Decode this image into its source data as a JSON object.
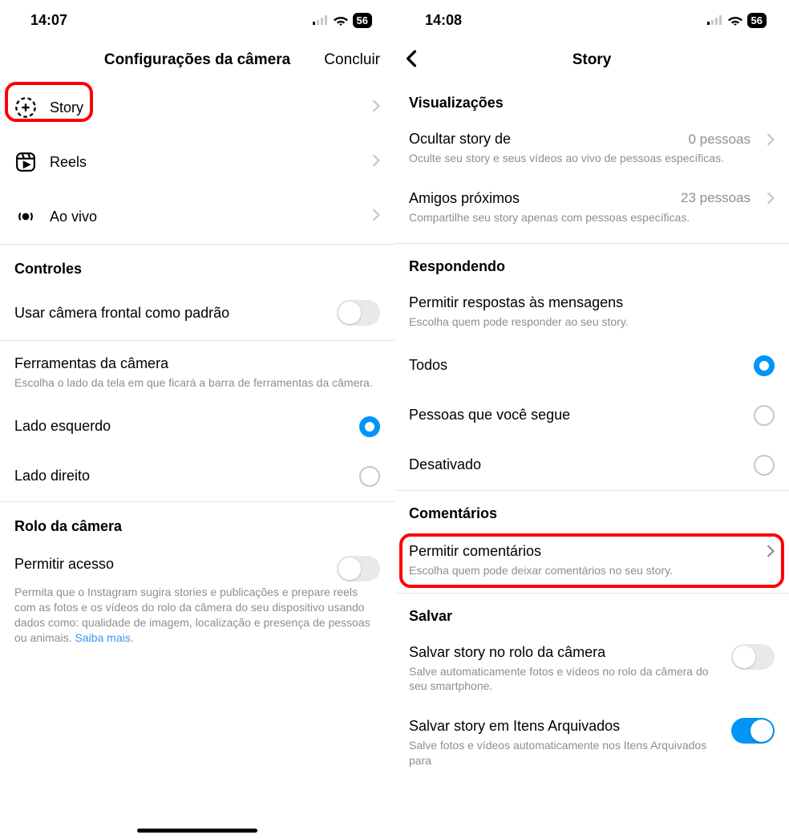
{
  "left": {
    "status": {
      "time": "14:07",
      "battery": "56"
    },
    "header": {
      "title": "Configurações da câmera",
      "done": "Concluir"
    },
    "menu": {
      "story": "Story",
      "reels": "Reels",
      "live": "Ao vivo"
    },
    "controls": {
      "heading": "Controles",
      "frontCameraDefault": "Usar câmera frontal como padrão",
      "cameraTools": {
        "title": "Ferramentas da câmera",
        "desc": "Escolha o lado da tela em que ficará a barra de ferramentas da câmera."
      },
      "leftSide": "Lado esquerdo",
      "rightSide": "Lado direito"
    },
    "cameraRoll": {
      "heading": "Rolo da câmera",
      "allowAccess": {
        "title": "Permitir acesso",
        "desc": "Permita que o Instagram sugira stories e publicações e prepare reels com as fotos e os vídeos do rolo da câmera do seu dispositivo usando dados como: qualidade de imagem, localização e presença de pessoas ou animais. ",
        "link": "Saiba mais"
      }
    }
  },
  "right": {
    "status": {
      "time": "14:08",
      "battery": "56"
    },
    "header": {
      "title": "Story"
    },
    "views": {
      "heading": "Visualizações",
      "hideStory": {
        "title": "Ocultar story de",
        "value": "0 pessoas",
        "desc": "Oculte seu story e seus vídeos ao vivo de pessoas específicas."
      },
      "closeFriends": {
        "title": "Amigos próximos",
        "value": "23 pessoas",
        "desc": "Compartilhe seu story apenas com pessoas específicas."
      }
    },
    "replying": {
      "heading": "Respondendo",
      "allowReplies": {
        "title": "Permitir respostas às mensagens",
        "desc": "Escolha quem pode responder ao seu story."
      },
      "options": {
        "everyone": "Todos",
        "following": "Pessoas que você segue",
        "off": "Desativado"
      }
    },
    "comments": {
      "heading": "Comentários",
      "allowComments": {
        "title": "Permitir comentários",
        "desc": "Escolha quem pode deixar comentários no seu story."
      }
    },
    "save": {
      "heading": "Salvar",
      "saveToRoll": {
        "title": "Salvar story no rolo da câmera",
        "desc": "Salve automaticamente fotos e vídeos no rolo da câmera do seu smartphone."
      },
      "saveToArchive": {
        "title": "Salvar story em Itens Arquivados",
        "desc": "Salve fotos e vídeos automaticamente nos Itens Arquivados para"
      }
    }
  }
}
